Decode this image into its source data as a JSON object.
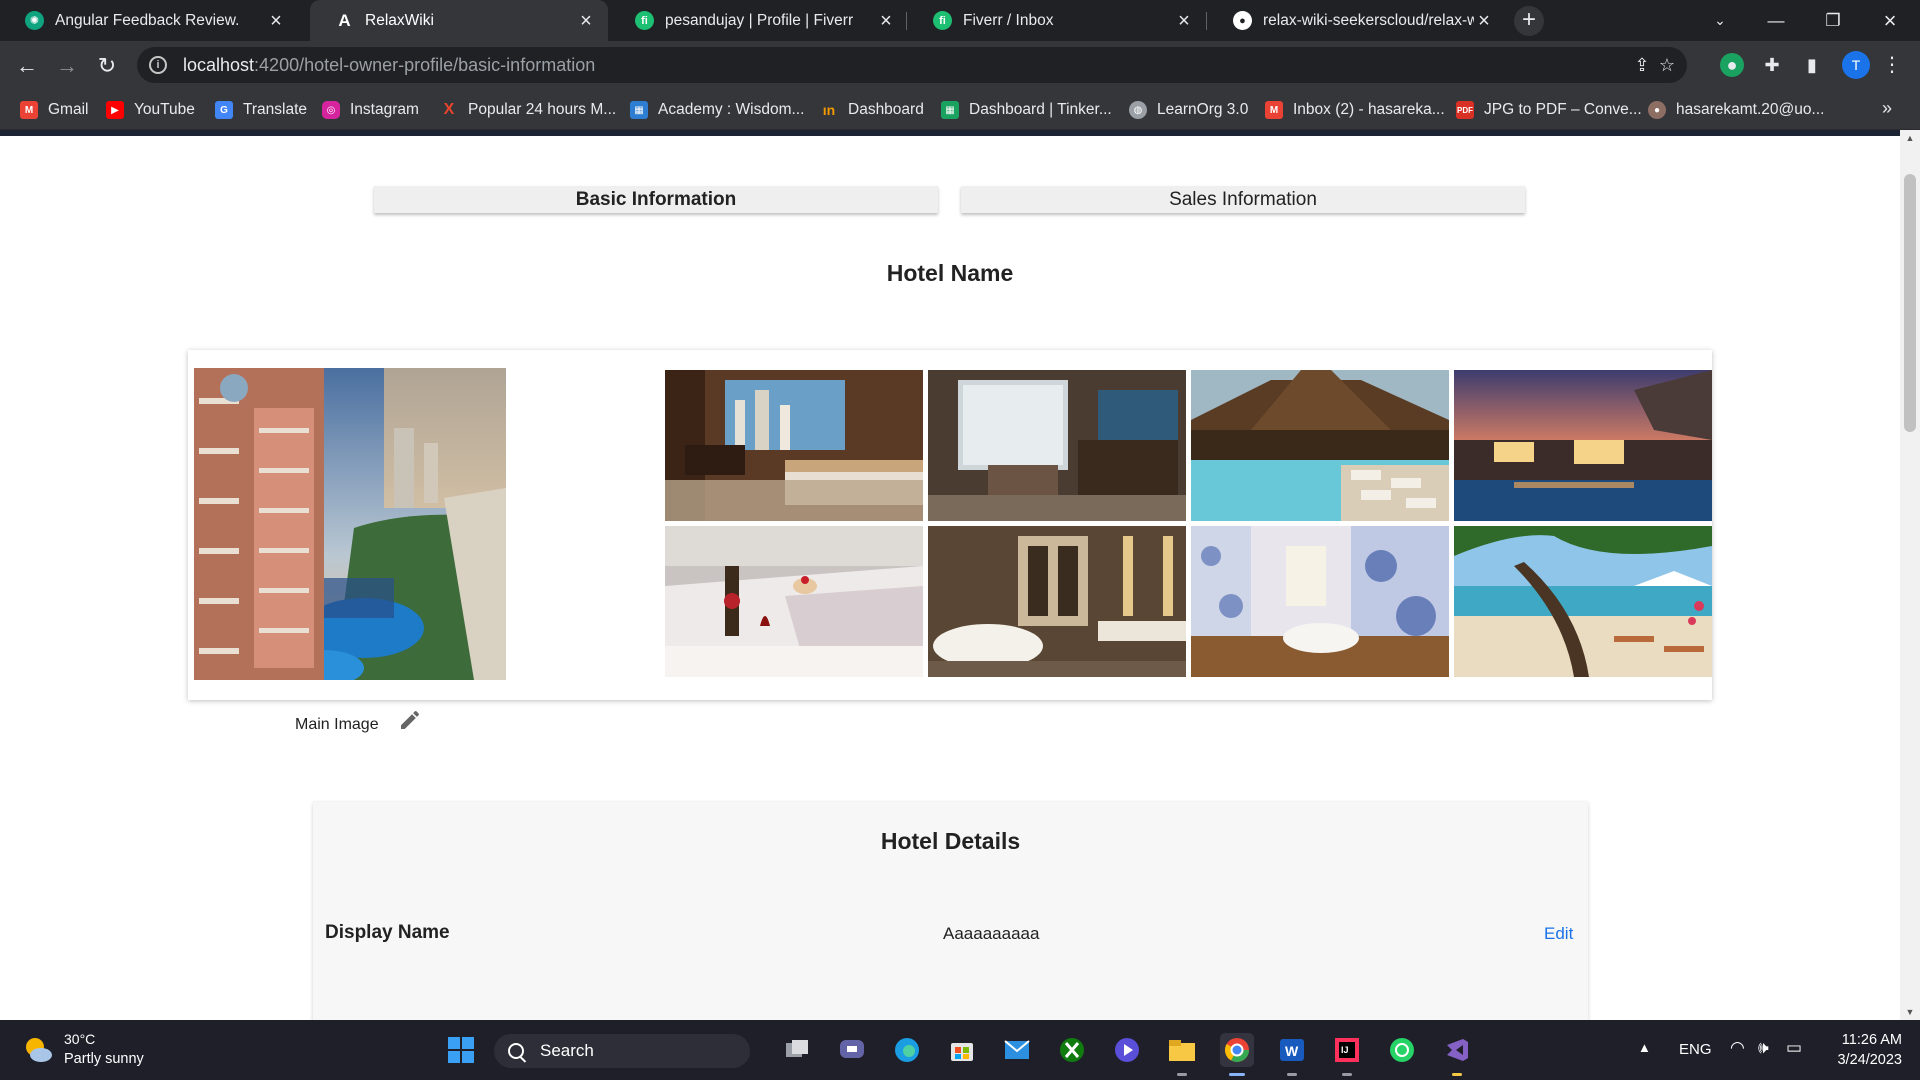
{
  "browser": {
    "tabs": [
      {
        "title": "Angular Feedback Review.",
        "favicon": "chatgpt-icon",
        "active": false
      },
      {
        "title": "RelaxWiki",
        "favicon": "angular-icon",
        "active": true
      },
      {
        "title": "pesandujay | Profile | Fiverr",
        "favicon": "fiverr-icon",
        "active": false
      },
      {
        "title": "Fiverr / Inbox",
        "favicon": "fiverr-icon",
        "active": false
      },
      {
        "title": "relax-wiki-seekerscloud/relax-wik",
        "favicon": "github-icon",
        "active": false
      }
    ],
    "url_host": "localhost",
    "url_path": ":4200/hotel-owner-profile/basic-information",
    "profile_initial": "T",
    "bookmarks": [
      {
        "label": "Gmail",
        "icon": "gmail-icon",
        "color": "#ea4335"
      },
      {
        "label": "YouTube",
        "icon": "youtube-icon",
        "color": "#ff0000"
      },
      {
        "label": "Translate",
        "icon": "translate-icon",
        "color": "#4285f4"
      },
      {
        "label": "Instagram",
        "icon": "instagram-icon",
        "color": "#d6249f"
      },
      {
        "label": "Popular 24 hours M...",
        "icon": "x-icon",
        "color": "#e8452c"
      },
      {
        "label": "Academy : Wisdom...",
        "icon": "academy-icon",
        "color": "#2d7dd2"
      },
      {
        "label": "Dashboard",
        "icon": "dashboard-icon",
        "color": "#f29900"
      },
      {
        "label": "Dashboard | Tinker...",
        "icon": "tinkercad-icon",
        "color": "#1aa260"
      },
      {
        "label": "LearnOrg 3.0",
        "icon": "globe-icon",
        "color": "#9aa0a6"
      },
      {
        "label": "Inbox (2) - hasareka...",
        "icon": "gmail-icon",
        "color": "#ea4335"
      },
      {
        "label": "JPG to PDF – Conve...",
        "icon": "pdf-icon",
        "color": "#d93025"
      },
      {
        "label": "hasarekamt.20@uo...",
        "icon": "person-icon",
        "color": "#8d6e63"
      }
    ]
  },
  "page": {
    "tabs": {
      "basic": "Basic Information",
      "sales": "Sales Information"
    },
    "hotel_name": "Hotel Name",
    "main_image_label": "Main Image",
    "gallery": [
      "hotel-room-city-view",
      "hotel-room-lounge",
      "resort-pool-deck",
      "sunset-cabana-pool",
      "bed-with-champagne",
      "bathroom-with-tub",
      "tiled-bathroom-tub",
      "beach-with-umbrellas"
    ],
    "details": {
      "title": "Hotel Details",
      "display_name_label": "Display Name",
      "display_name_value": "Aaaaaaaaaa",
      "edit_label": "Edit"
    }
  },
  "taskbar": {
    "weather_temp": "30°C",
    "weather_cond": "Partly sunny",
    "search_label": "Search",
    "language": "ENG",
    "time": "11:26 AM",
    "date": "3/24/2023"
  },
  "colors": {
    "accent_link": "#1a73e8",
    "chrome_dark": "#202124",
    "chrome_toolbar": "#35363a",
    "taskbar": "#1f1f2a"
  }
}
